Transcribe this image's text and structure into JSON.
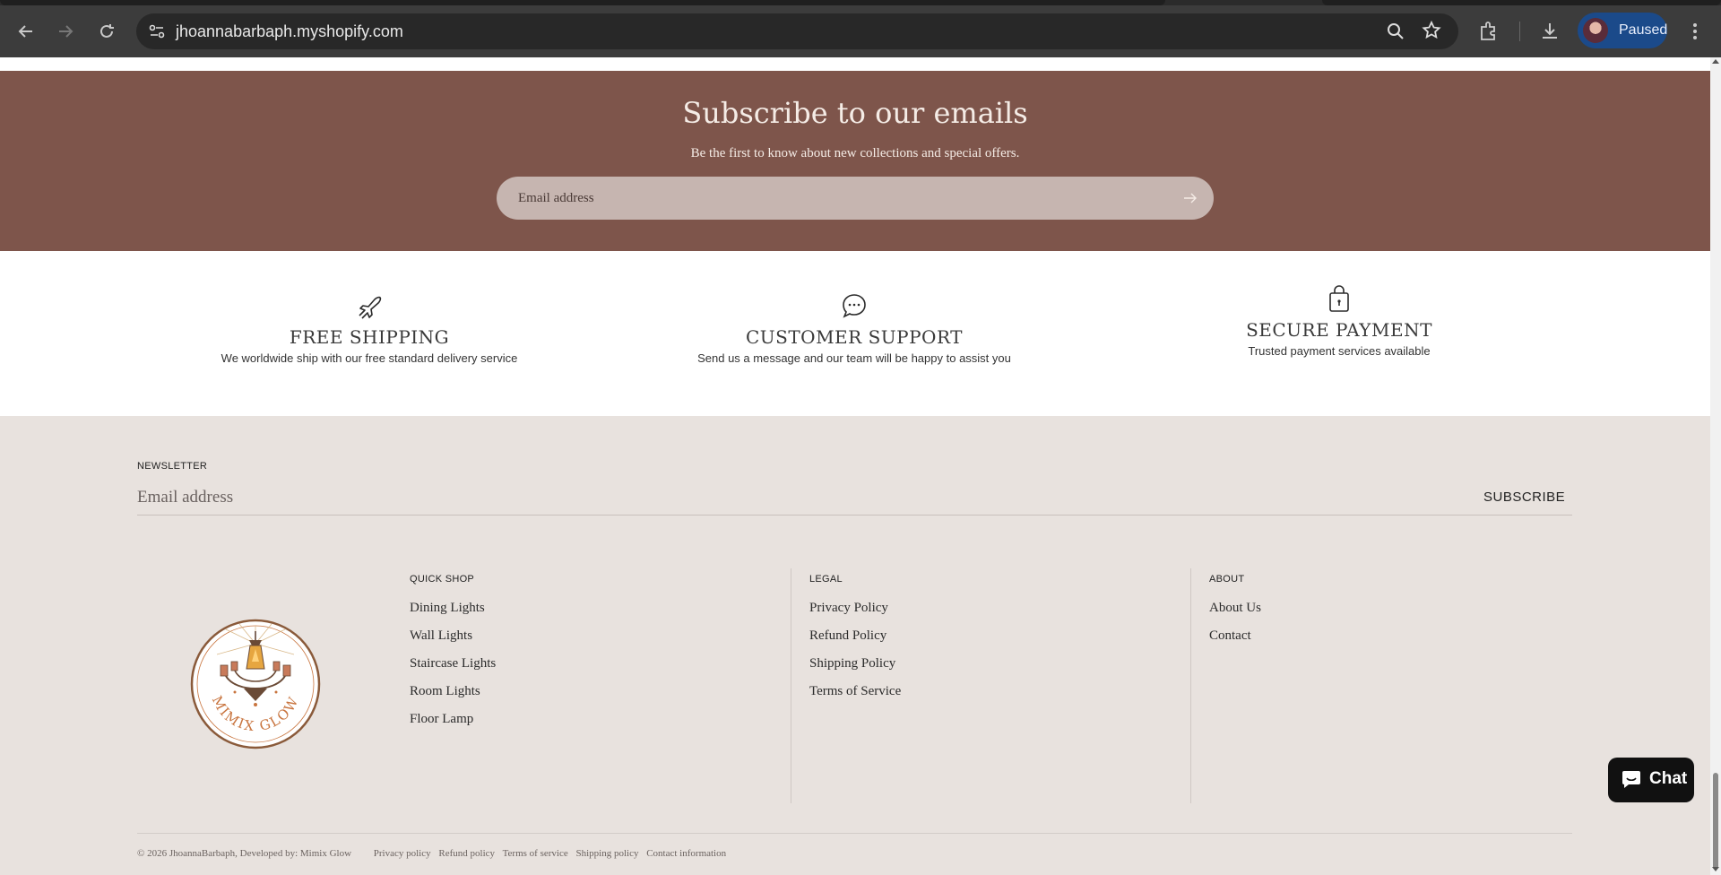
{
  "browser": {
    "url": "jhoannabarbaph.myshopify.com",
    "profile_status": "Paused"
  },
  "subscribe_banner": {
    "title": "Subscribe to our emails",
    "subtitle": "Be the first to know about new collections and special offers.",
    "email_placeholder": "Email address"
  },
  "features": [
    {
      "title": "FREE SHIPPING",
      "description": "We worldwide ship with our free standard delivery service",
      "icon": "plane-icon"
    },
    {
      "title": "CUSTOMER SUPPORT",
      "description": "Send us a message and our team will be happy to assist you",
      "icon": "chat-bubble-icon"
    },
    {
      "title": "SECURE PAYMENT",
      "description": "Trusted payment services available",
      "icon": "secure-bag-icon"
    }
  ],
  "footer": {
    "newsletter_label": "NEWSLETTER",
    "newsletter_placeholder": "Email address",
    "subscribe_label": "SUBSCRIBE",
    "logo_text": "MIMIX GLOW",
    "columns": [
      {
        "title": "QUICK SHOP",
        "items": [
          "Dining Lights",
          "Wall Lights",
          "Staircase Lights",
          "Room Lights",
          "Floor Lamp"
        ]
      },
      {
        "title": "LEGAL",
        "items": [
          "Privacy Policy",
          "Refund Policy",
          "Shipping Policy",
          "Terms of Service"
        ]
      },
      {
        "title": "ABOUT",
        "items": [
          "About Us",
          "Contact"
        ]
      }
    ],
    "copyright": "© 2026 JhoannaBarbaph, Developed by: Mimix Glow",
    "legal_links": [
      "Privacy policy",
      "Refund policy",
      "Terms of service",
      "Shipping policy",
      "Contact information"
    ]
  },
  "chat": {
    "label": "Chat"
  },
  "colors": {
    "banner": "#7e554b",
    "footer_bg": "#e8e2de",
    "logo_accent": "#c8743e"
  }
}
